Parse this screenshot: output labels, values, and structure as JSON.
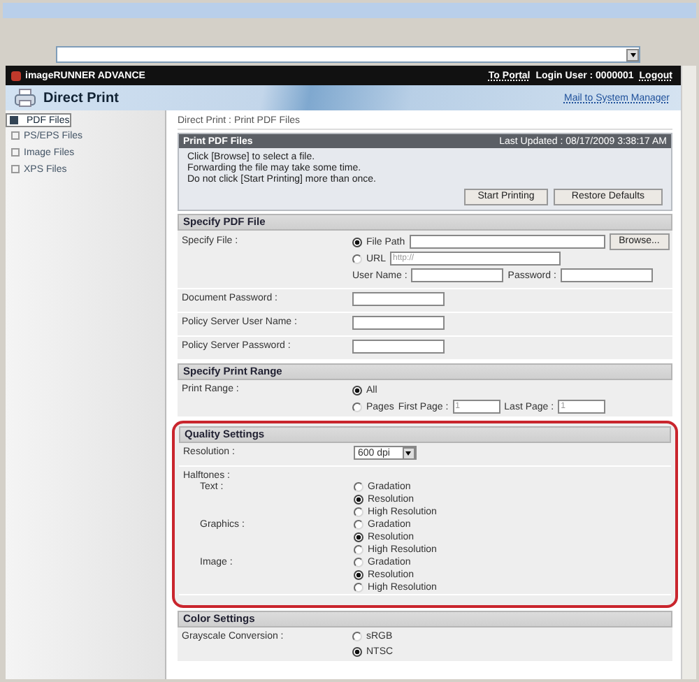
{
  "header": {
    "brand": "imageRUNNER ADVANCE",
    "portal_link": "To Portal",
    "login_user": "Login User : 0000001",
    "logout_link": "Logout"
  },
  "banner": {
    "title": "Direct Print",
    "mail_link": "Mail to System Manager"
  },
  "sidebar": {
    "items": [
      {
        "label": "PDF Files",
        "selected": true
      },
      {
        "label": "PS/EPS Files",
        "selected": false
      },
      {
        "label": "Image Files",
        "selected": false
      },
      {
        "label": "XPS Files",
        "selected": false
      }
    ]
  },
  "breadcrumb": "Direct Print : Print PDF Files",
  "intro_panel": {
    "title": "Print PDF Files",
    "last_updated": "Last Updated : 08/17/2009 3:38:17 AM",
    "lines": [
      "Click [Browse] to select a file.",
      "Forwarding the file may take some time.",
      "Do not click [Start Printing] more than once."
    ],
    "buttons": [
      "Start Printing",
      "Restore Defaults"
    ]
  },
  "specify_file": {
    "title": "Specify PDF File",
    "label": "Specify File :",
    "file_path": {
      "label": "File Path",
      "selected": true
    },
    "browse_button": "Browse...",
    "url": {
      "label": "URL",
      "selected": false,
      "placeholder": "http://"
    },
    "user_name_label": "User Name :",
    "password_label": "Password :",
    "fields": [
      {
        "label": "Document Password :"
      },
      {
        "label": "Policy Server User Name :"
      },
      {
        "label": "Policy Server Password :"
      }
    ]
  },
  "print_range": {
    "title": "Specify Print Range",
    "label": "Print Range :",
    "all": {
      "label": "All",
      "selected": true
    },
    "pages": {
      "label": "Pages",
      "selected": false
    },
    "first_page_label": "First Page :",
    "first_page_value": "1",
    "last_page_label": "Last Page :",
    "last_page_value": "1"
  },
  "quality": {
    "title": "Quality Settings",
    "highlighted": true,
    "resolution_label": "Resolution :",
    "resolution_value": "600 dpi",
    "halftones_label": "Halftones :",
    "groups": [
      {
        "label": "Text :",
        "options": [
          {
            "label": "Gradation",
            "selected": false
          },
          {
            "label": "Resolution",
            "selected": true
          },
          {
            "label": "High Resolution",
            "selected": false
          }
        ]
      },
      {
        "label": "Graphics :",
        "options": [
          {
            "label": "Gradation",
            "selected": false
          },
          {
            "label": "Resolution",
            "selected": true
          },
          {
            "label": "High Resolution",
            "selected": false
          }
        ]
      },
      {
        "label": "Image :",
        "options": [
          {
            "label": "Gradation",
            "selected": false
          },
          {
            "label": "Resolution",
            "selected": true
          },
          {
            "label": "High Resolution",
            "selected": false
          }
        ]
      }
    ]
  },
  "color": {
    "title": "Color Settings",
    "grayscale_label": "Grayscale Conversion :",
    "options": [
      {
        "label": "sRGB",
        "selected": false
      },
      {
        "label": "NTSC",
        "selected": true
      }
    ]
  }
}
